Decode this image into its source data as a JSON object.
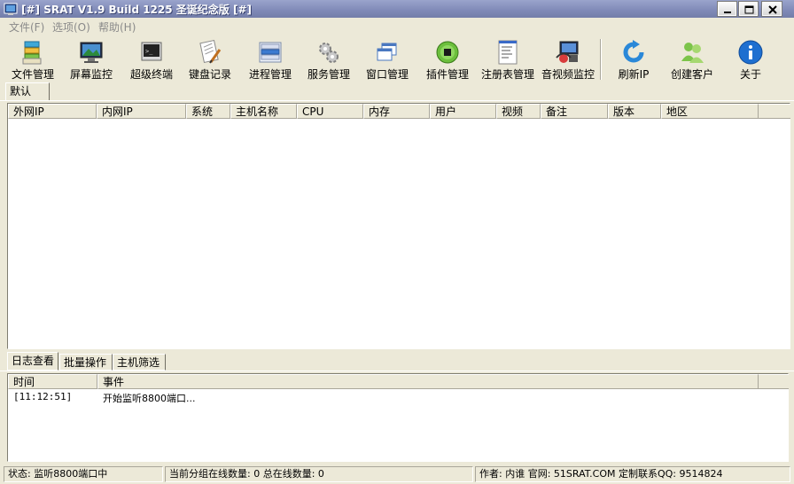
{
  "window": {
    "title": "[#] SRAT V1.9 Build 1225 圣诞纪念版 [#]"
  },
  "menu": [
    {
      "label": "文件(F)"
    },
    {
      "label": "选项(O)"
    },
    {
      "label": "帮助(H)"
    }
  ],
  "toolbar": [
    {
      "label": "文件管理",
      "icon": "file-manager-icon"
    },
    {
      "label": "屏幕监控",
      "icon": "screen-monitor-icon"
    },
    {
      "label": "超级终端",
      "icon": "terminal-icon"
    },
    {
      "label": "键盘记录",
      "icon": "keylogger-icon"
    },
    {
      "label": "进程管理",
      "icon": "process-manager-icon"
    },
    {
      "label": "服务管理",
      "icon": "service-manager-icon"
    },
    {
      "label": "窗口管理",
      "icon": "window-manager-icon"
    },
    {
      "label": "插件管理",
      "icon": "plugin-manager-icon"
    },
    {
      "label": "注册表管理",
      "icon": "registry-manager-icon"
    },
    {
      "label": "音视频监控",
      "icon": "av-monitor-icon"
    },
    {
      "label": "刷新IP",
      "icon": "refresh-icon"
    },
    {
      "label": "创建客户",
      "icon": "create-client-icon"
    },
    {
      "label": "关于",
      "icon": "info-icon"
    }
  ],
  "tabs": {
    "default_label": "默认"
  },
  "host_columns": [
    "外网IP",
    "内网IP",
    "系统",
    "主机名称",
    "CPU",
    "内存",
    "用户",
    "视频",
    "备注",
    "版本",
    "地区"
  ],
  "bottom_tabs": [
    "日志查看",
    "批量操作",
    "主机筛选"
  ],
  "log": {
    "columns": [
      "时间",
      "事件"
    ],
    "rows": [
      {
        "time": "[11:12:51]",
        "event": "开始监听8800端口..."
      }
    ]
  },
  "status": {
    "state": "状态: 监听8800端口中",
    "counts": "当前分组在线数量: 0   总在线数量: 0",
    "author": "作者: 内谁 官网: 51SRAT.COM 定制联系QQ: 9514824"
  }
}
